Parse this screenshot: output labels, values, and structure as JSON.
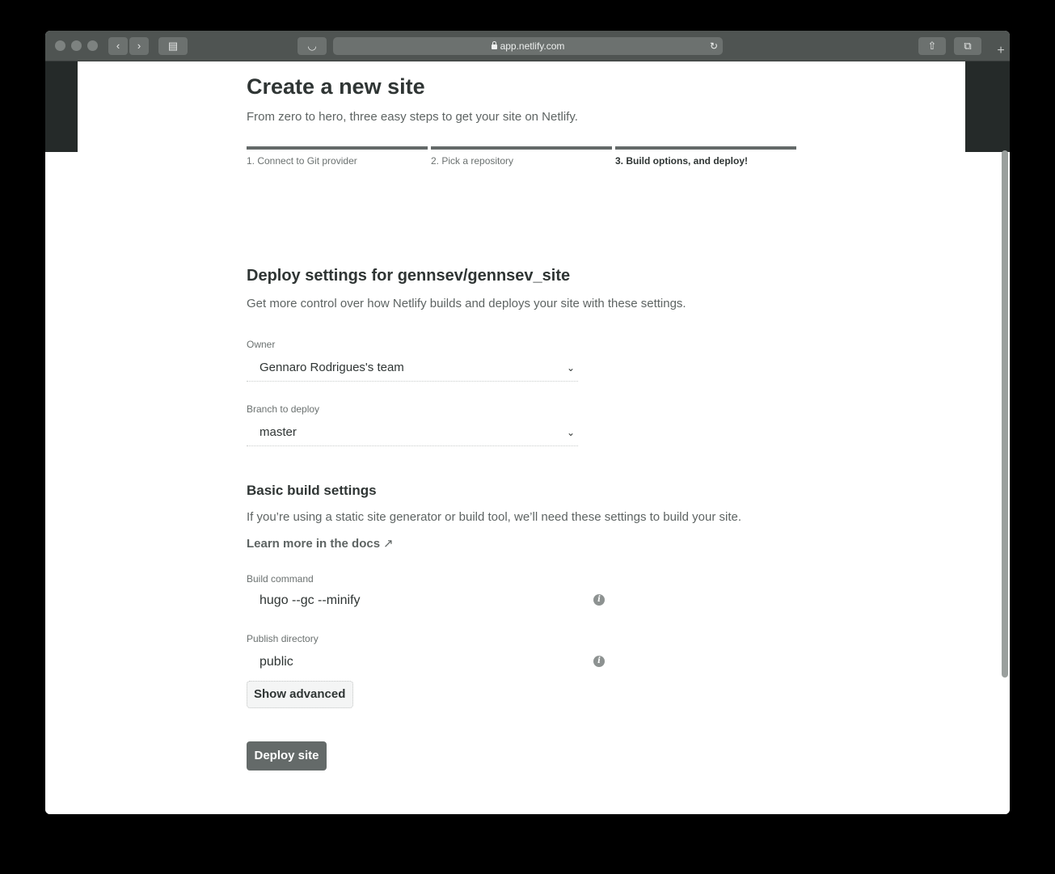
{
  "browser": {
    "url": "app.netlify.com",
    "tab_add": "+"
  },
  "header": {
    "title": "Create a new site",
    "subtitle": "From zero to hero, three easy steps to get your site on Netlify."
  },
  "steps": [
    {
      "label": "1. Connect to Git provider"
    },
    {
      "label": "2. Pick a repository"
    },
    {
      "label": "3. Build options, and deploy!"
    }
  ],
  "deploy_settings": {
    "heading": "Deploy settings for gennsev/gennsev_site",
    "description": "Get more control over how Netlify builds and deploys your site with these settings.",
    "owner": {
      "label": "Owner",
      "value": "Gennaro Rodrigues's team"
    },
    "branch": {
      "label": "Branch to deploy",
      "value": "master"
    }
  },
  "build_settings": {
    "heading": "Basic build settings",
    "description": "If you’re using a static site generator or build tool, we’ll need these settings to build your site.",
    "docs_link": "Learn more in the docs",
    "docs_arrow": "↗",
    "build_command": {
      "label": "Build command",
      "value": "hugo --gc --minify"
    },
    "publish_directory": {
      "label": "Publish directory",
      "value": "public"
    }
  },
  "buttons": {
    "show_advanced": "Show advanced",
    "deploy": "Deploy site"
  }
}
